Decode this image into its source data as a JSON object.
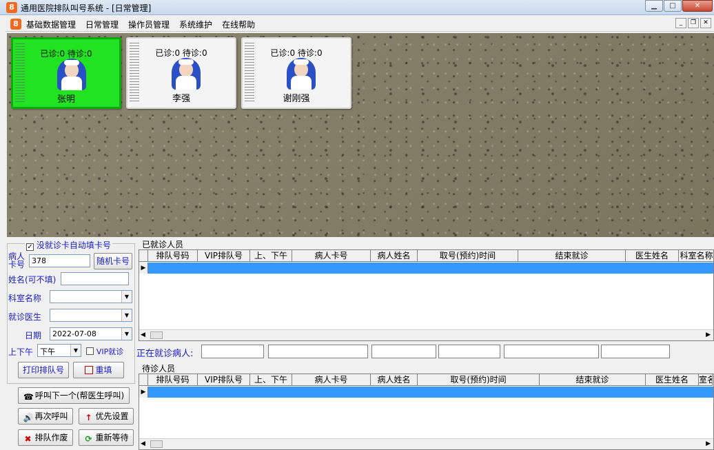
{
  "window": {
    "title": "通用医院排队叫号系统      - [日常管理]",
    "icon_glyph": "8"
  },
  "menu": {
    "items": [
      "基础数据管理",
      "日常管理",
      "操作员管理",
      "系统维护",
      "在线帮助"
    ]
  },
  "doctors": [
    {
      "stats": "已诊:0 待诊:0",
      "name": "张明",
      "active": true
    },
    {
      "stats": "已诊:0 待诊:0",
      "name": "李强",
      "active": false
    },
    {
      "stats": "已诊:0 待诊:0",
      "name": "谢刚强",
      "active": false
    }
  ],
  "form": {
    "auto_fill_label": "没就诊卡自动填卡号",
    "auto_fill_checked": true,
    "card_label": "病人\n卡号",
    "card_value": "378",
    "random_card_button": "随机卡号",
    "name_label": "姓名(可不填)",
    "name_value": "",
    "dept_label": "科室名称",
    "dept_value": "",
    "doctor_label": "就诊医生",
    "doctor_value": "",
    "date_label": "日期",
    "date_value": "2022-07-08",
    "ampm_label": "上下午",
    "ampm_value": "下午",
    "vip_label": "VIP就诊",
    "vip_checked": false,
    "print_button": "打印排队号",
    "reset_button": "重填",
    "call_next_button": "呼叫下一个(帮医生呼叫)",
    "call_again_button": "再次呼叫",
    "priority_button": "优先设置",
    "void_button": "排队作废",
    "requeue_button": "重新等待"
  },
  "done_grid": {
    "caption": "已就诊人员",
    "columns": [
      "排队号码",
      "VIP排队号",
      "上、下午",
      "病人卡号",
      "病人姓名",
      "取号(预约)时间",
      "结束就诊",
      "医生姓名",
      "科室名称"
    ]
  },
  "current": {
    "label": "正在就诊病人:"
  },
  "waiting_grid": {
    "caption": "待诊人员",
    "columns": [
      "排队号码",
      "VIP排队号",
      "上、下午",
      "病人卡号",
      "病人姓名",
      "取号(预约)时间",
      "结束就诊",
      "医生姓名",
      "室名"
    ]
  }
}
